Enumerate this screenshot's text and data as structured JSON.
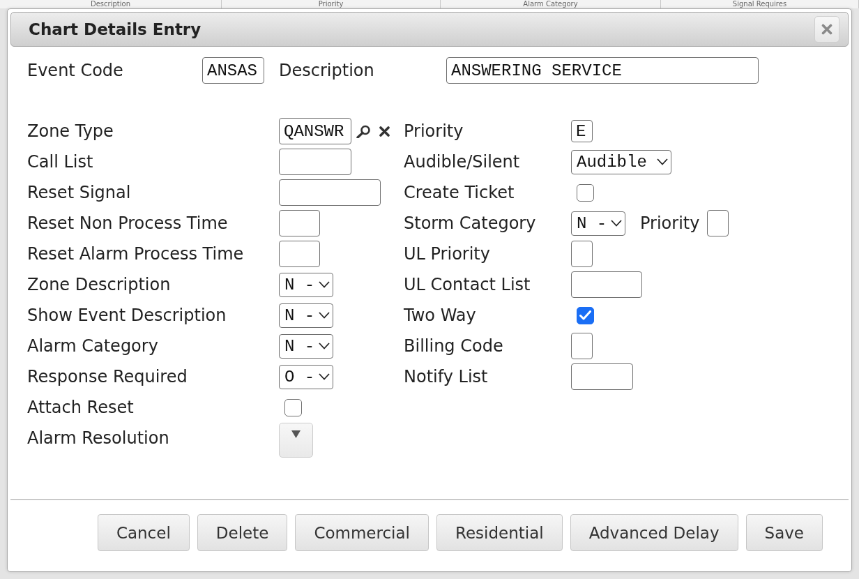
{
  "background_table": {
    "columns": [
      "Description",
      "Priority",
      "Alarm Category",
      "Signal Requires"
    ]
  },
  "dialog": {
    "title": "Chart Details Entry"
  },
  "header_fields": [
    {
      "label": "Event Code",
      "value": "ANSAS"
    },
    {
      "label": "Description",
      "value": "ANSWERING SERVICE"
    }
  ],
  "left_fields": [
    {
      "kind": "lookup",
      "label": "Zone Type",
      "value": "QANSWR"
    },
    {
      "kind": "text",
      "label": "Call List"
    },
    {
      "kind": "text",
      "label": "Reset Signal"
    },
    {
      "kind": "text",
      "label": "Reset Non Process Time"
    },
    {
      "kind": "text",
      "label": "Reset Alarm Process Time"
    },
    {
      "kind": "select",
      "label": "Zone Description",
      "value": "N -"
    },
    {
      "kind": "select",
      "label": "Show Event Description",
      "value": "N -"
    },
    {
      "kind": "select",
      "label": "Alarm Category",
      "value": "N -"
    },
    {
      "kind": "select",
      "label": "Response Required",
      "value": "O -"
    },
    {
      "kind": "checkbox",
      "label": "Attach Reset",
      "checked": false
    },
    {
      "kind": "menu",
      "label": "Alarm Resolution"
    }
  ],
  "right_fields": [
    {
      "kind": "text",
      "label": "Priority",
      "value": "E"
    },
    {
      "kind": "select",
      "label": "Audible/Silent",
      "value": "Audible"
    },
    {
      "kind": "checkbox",
      "label": "Create Ticket",
      "checked": false
    },
    {
      "kind": "select",
      "label": "Storm Category",
      "value": "N -",
      "extra": {
        "label": "Priority"
      }
    },
    {
      "kind": "text",
      "label": "UL Priority"
    },
    {
      "kind": "text",
      "label": "UL Contact List"
    },
    {
      "kind": "checkbox",
      "label": "Two Way",
      "checked": true
    },
    {
      "kind": "text",
      "label": "Billing Code"
    },
    {
      "kind": "text",
      "label": "Notify List"
    }
  ],
  "buttons": [
    "Cancel",
    "Delete",
    "Commercial",
    "Residential",
    "Advanced Delay",
    "Save"
  ]
}
